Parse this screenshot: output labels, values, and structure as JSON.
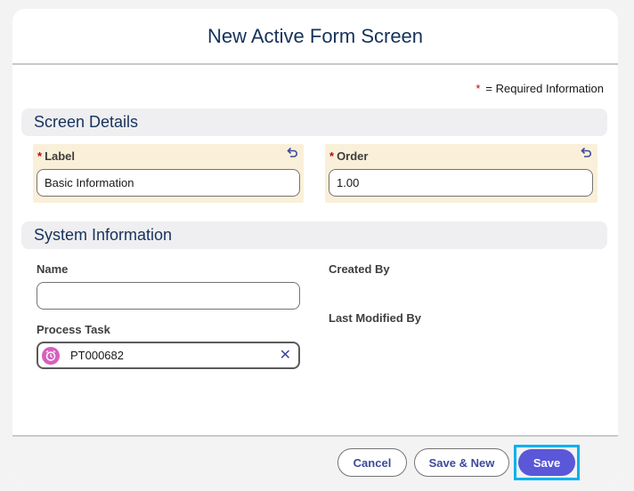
{
  "modal": {
    "title": "New Active Form Screen",
    "required_star": "*",
    "required_note": "= Required Information"
  },
  "screen_details": {
    "section_title": "Screen Details",
    "label_field": {
      "star": "*",
      "label": "Label",
      "value": "Basic Information",
      "icon": "undo-icon"
    },
    "order_field": {
      "star": "*",
      "label": "Order",
      "value": "1.00",
      "icon": "undo-icon"
    }
  },
  "system_information": {
    "section_title": "System Information",
    "name_label": "Name",
    "name_value": "",
    "process_task_label": "Process Task",
    "process_task_value": "PT000682",
    "process_task_icon": "process-task-icon",
    "clear_icon": "close-icon",
    "created_by_label": "Created By",
    "last_modified_label": "Last Modified By"
  },
  "footer": {
    "cancel_label": "Cancel",
    "save_new_label": "Save & New",
    "save_label": "Save"
  },
  "colors": {
    "accent": "#5a57d8",
    "edited_field_bg": "#faf0d9",
    "focus_ring": "#00b2ee",
    "required": "#ba0517"
  }
}
